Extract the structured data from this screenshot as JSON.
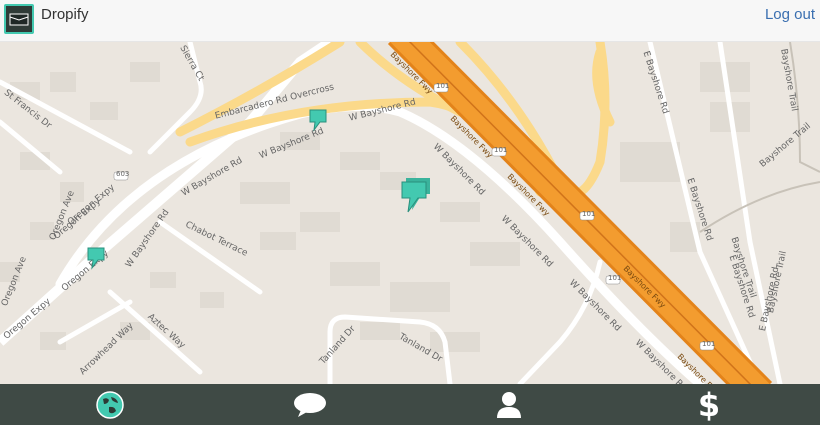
{
  "header": {
    "app_name": "Dropify",
    "logout_label": "Log out"
  },
  "map": {
    "labels": {
      "bayshore_fwy": "Bayshore Fwy",
      "w_bayshore_rd": "W Bayshore Rd",
      "e_bayshore_rd": "E Bayshore Rd",
      "oregon_expy": "Oregon Expy",
      "oregon_ave": "Oregon Ave",
      "st_francis_dr": "St Francis Dr",
      "chabot_terrace": "Chabot Terrace",
      "aztec_way": "Aztec Way",
      "arrowhead_way": "Arrowhead Way",
      "tanland_dr": "Tanland Dr",
      "embarcadero": "Embarcadero Rd Overcross",
      "sierra_ct": "Sierra Ct",
      "rd_101": "101",
      "rd_603": "603",
      "bayshore_trail": "Bayshore Trail"
    },
    "pins": [
      "drop-pin",
      "drop-pin",
      "drop-pin"
    ]
  },
  "nav": {
    "items": [
      {
        "icon": "globe-icon"
      },
      {
        "icon": "chat-icon"
      },
      {
        "icon": "user-icon"
      },
      {
        "icon": "dollar-icon"
      }
    ],
    "active_color": "#43c9b0",
    "icon_color": "#ffffff"
  },
  "colors": {
    "freeway": "#f39c2f",
    "major_road": "#fbd98a",
    "pin": "#43c9b0"
  }
}
